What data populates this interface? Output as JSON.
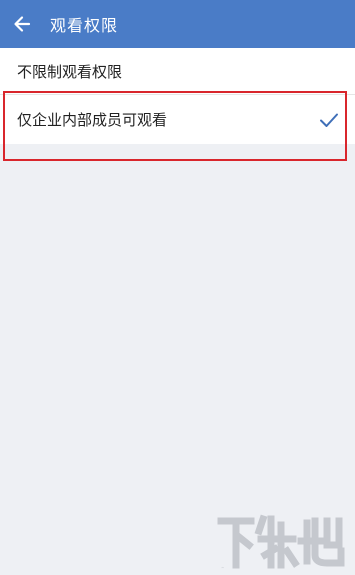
{
  "app_bar": {
    "title": "观看权限",
    "background_color": "#4a7cc7",
    "back_icon": "arrow-left-icon"
  },
  "options": [
    {
      "label": "不限制观看权限",
      "selected": false
    },
    {
      "label": "仅企业内部成员可观看",
      "selected": true,
      "check_icon": "checkmark-icon"
    }
  ],
  "highlight": {
    "color": "#d9262c",
    "target": "仅企业内部成员可观看"
  },
  "watermark": {
    "text": "下载吧"
  }
}
